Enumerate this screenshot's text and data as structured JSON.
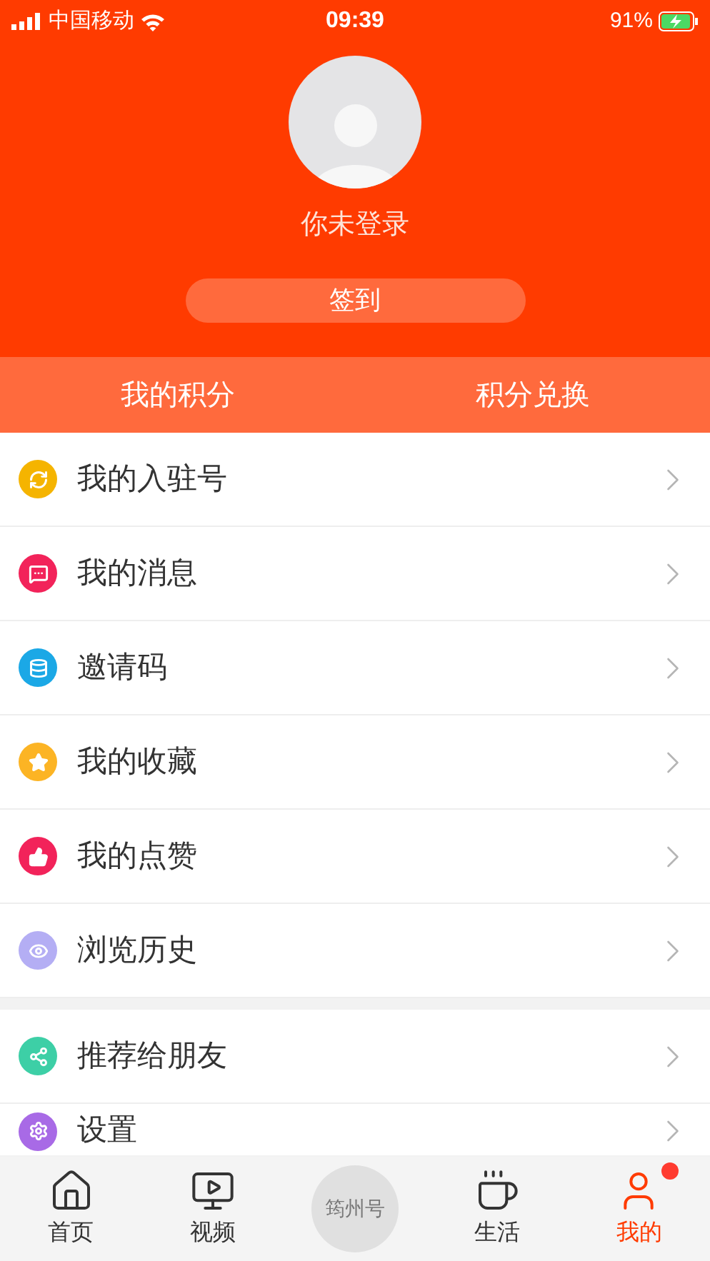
{
  "status_bar": {
    "carrier": "中国移动",
    "time": "09:39",
    "battery": "91%"
  },
  "profile": {
    "name": "你未登录",
    "signin_button": "签到"
  },
  "points_bar": [
    "我的积分",
    "积分兑换"
  ],
  "menu_groups": [
    [
      {
        "label": "我的入驻号",
        "kind": "badge",
        "color": "#f5b400"
      },
      {
        "label": "我的消息",
        "kind": "message",
        "color": "#f2235a"
      },
      {
        "label": "邀请码",
        "kind": "database",
        "color": "#1ba8e6"
      },
      {
        "label": "我的收藏",
        "kind": "star",
        "color": "#fcb424"
      },
      {
        "label": "我的点赞",
        "kind": "thumb",
        "color": "#f2235a"
      },
      {
        "label": "浏览历史",
        "kind": "eye",
        "color": "#b4aef4"
      }
    ],
    [
      {
        "label": "推荐给朋友",
        "kind": "share",
        "color": "#3dcfa6"
      },
      {
        "label": "设置",
        "kind": "gear",
        "color": "#a86ae6"
      }
    ]
  ],
  "tab_bar": [
    {
      "label": "首页",
      "kind": "home",
      "selected": false,
      "badge": false
    },
    {
      "label": "视频",
      "kind": "video",
      "selected": false,
      "badge": false
    },
    {
      "label": "筠州号",
      "kind": "center",
      "selected": false,
      "badge": false
    },
    {
      "label": "生活",
      "kind": "life",
      "selected": false,
      "badge": false
    },
    {
      "label": "我的",
      "kind": "me",
      "selected": true,
      "badge": true
    }
  ]
}
